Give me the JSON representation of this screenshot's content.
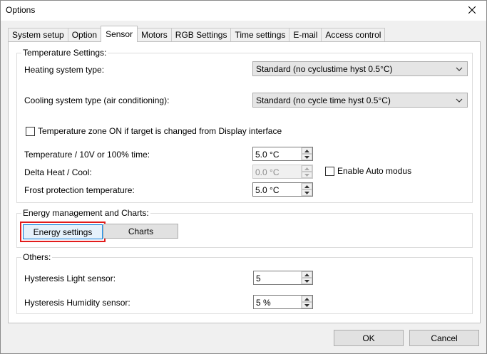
{
  "window": {
    "title": "Options"
  },
  "tabs": [
    {
      "label": "System setup",
      "active": false
    },
    {
      "label": "Option",
      "active": false
    },
    {
      "label": "Sensor",
      "active": true
    },
    {
      "label": "Motors",
      "active": false
    },
    {
      "label": "RGB Settings",
      "active": false
    },
    {
      "label": "Time settings",
      "active": false
    },
    {
      "label": "E-mail",
      "active": false
    },
    {
      "label": "Access control",
      "active": false
    }
  ],
  "temperature": {
    "group_title": "Temperature Settings:",
    "heating_label": "Heating system type:",
    "heating_value": "Standard (no cyclustime hyst 0.5°C)",
    "cooling_label": "Cooling system type (air conditioning):",
    "cooling_value": "Standard (no cycle time hyst 0.5°C)",
    "zone_checkbox_label": "Temperature zone ON if target is changed from Display interface",
    "zone_checked": false,
    "temp_time_label": "Temperature / 10V or 100% time:",
    "temp_time_value": "5.0 °C",
    "delta_label": "Delta Heat / Cool:",
    "delta_value": "0.0 °C",
    "frost_label": "Frost protection temperature:",
    "frost_value": "5.0 °C",
    "auto_modus_label": "Enable Auto modus",
    "auto_modus_checked": false
  },
  "energy": {
    "group_title": "Energy management and Charts:",
    "energy_settings_label": "Energy settings",
    "charts_label": "Charts",
    "highlight_color": "#e21b1b"
  },
  "others": {
    "group_title": "Others:",
    "light_label": "Hysteresis Light sensor:",
    "light_value": "5",
    "humidity_label": "Hysteresis Humidity sensor:",
    "humidity_value": "5 %"
  },
  "footer": {
    "ok_label": "OK",
    "cancel_label": "Cancel"
  },
  "icons": {
    "close": "close-icon",
    "dropdown": "chevron-down-icon",
    "spin_up": "arrow-up-icon",
    "spin_down": "arrow-down-icon"
  }
}
